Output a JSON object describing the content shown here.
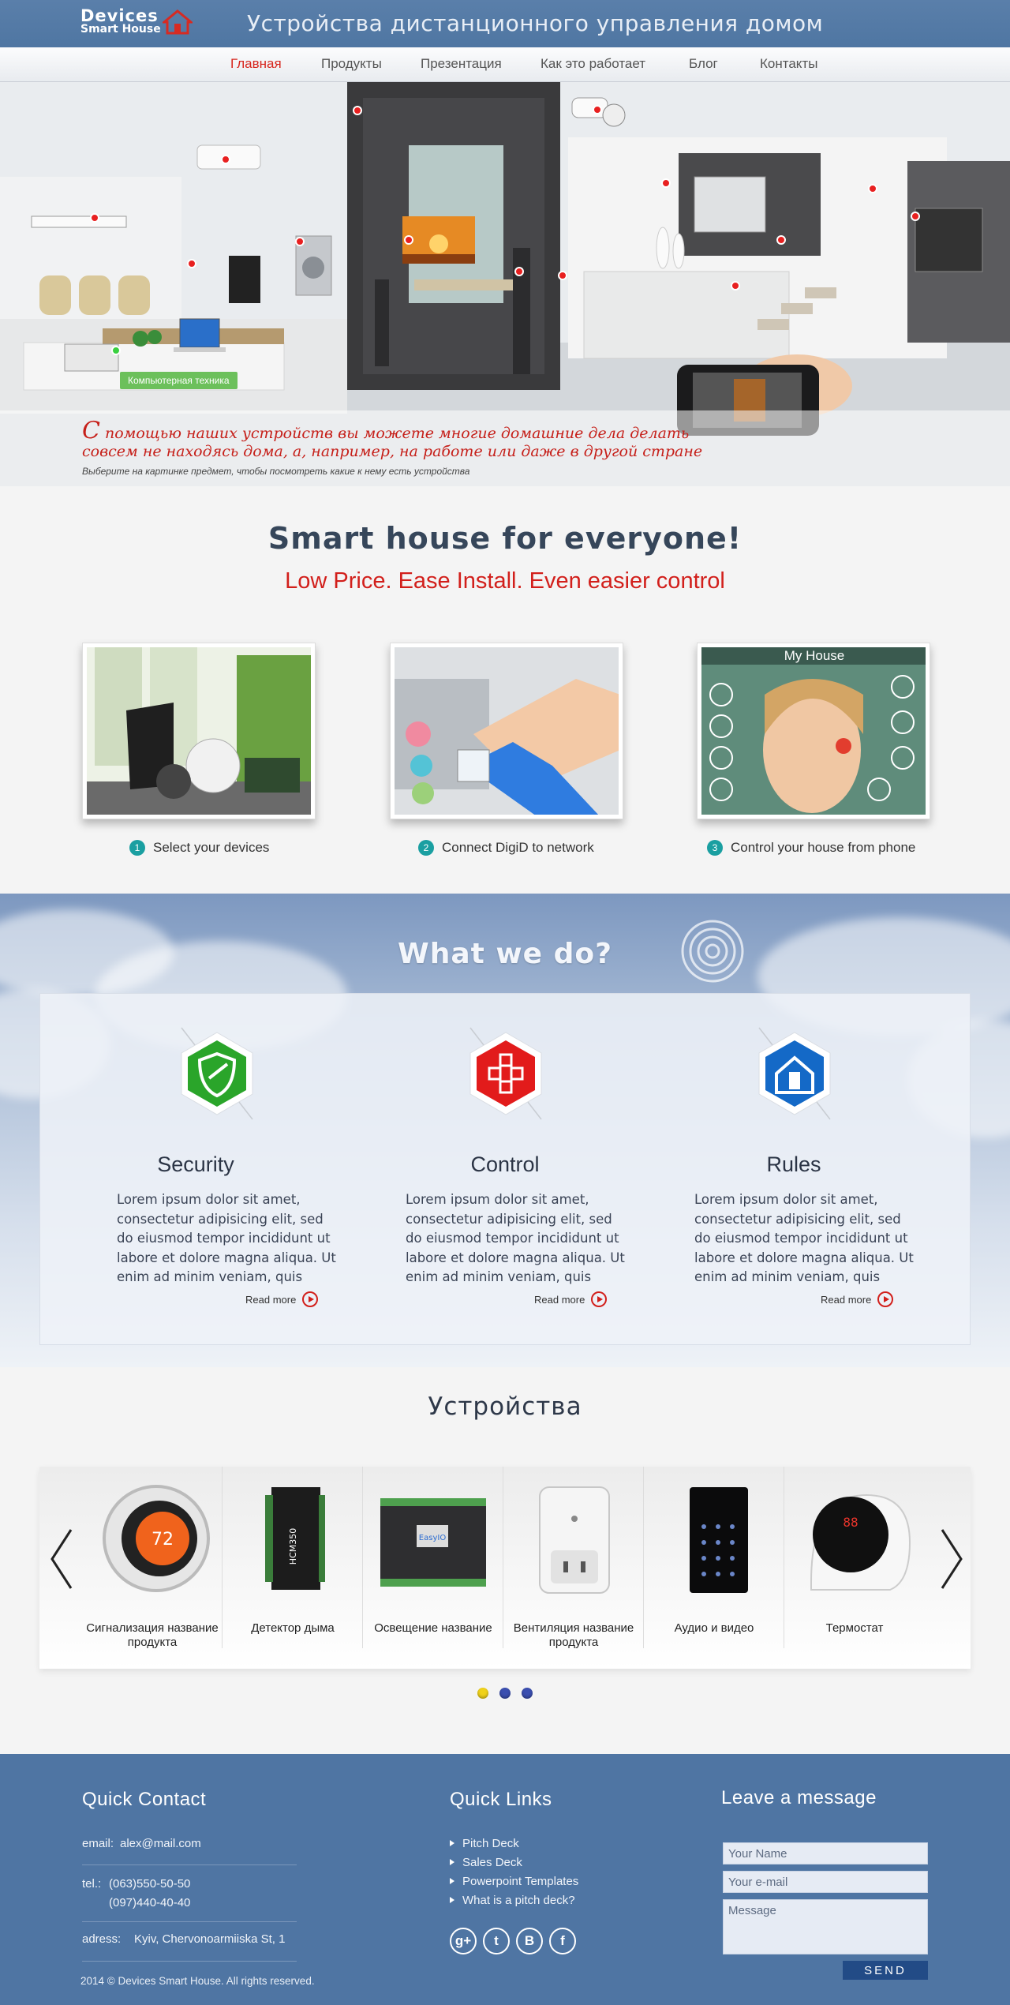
{
  "header": {
    "logo_line1": "Devices",
    "logo_line2": "Smart House",
    "site_title": "Устройства дистанционного управления домом"
  },
  "nav": {
    "items": [
      {
        "label": "Главная",
        "active": true
      },
      {
        "label": "Продукты",
        "active": false
      },
      {
        "label": "Презентация",
        "active": false
      },
      {
        "label": "Как это работает",
        "active": false
      },
      {
        "label": "Блог",
        "active": false
      },
      {
        "label": "Контакты",
        "active": false
      }
    ]
  },
  "hero": {
    "tag": "Компьютерная техника",
    "caption_first_letter": "С",
    "caption_line1_rest": " помощью наших устройств вы можете многие домашние дела делать",
    "caption_line2": "совсем не находясь дома, а, например, на работе или даже в другой стране",
    "caption_hint": "Выберите на картинке предмет, чтобы посмотреть какие к нему есть устройства"
  },
  "intro": {
    "title": "Smart house for everyone!",
    "subtitle": "Low Price. Ease Install. Even easier control",
    "steps": [
      {
        "num": "1",
        "label": "Select your devices"
      },
      {
        "num": "2",
        "label": "Connect DigiD to network"
      },
      {
        "num": "3",
        "label": "Control your house from phone",
        "image_title": "My House"
      }
    ]
  },
  "services": {
    "title": "What we do?",
    "items": [
      {
        "title": "Security",
        "text": "Lorem ipsum dolor sit amet, consectetur adipisicing elit, sed do eiusmod tempor incididunt ut labore et dolore magna aliqua. Ut enim ad minim veniam, quis",
        "read_more": "Read more",
        "icon": "shield-icon",
        "color": "#2aa52a"
      },
      {
        "title": "Control",
        "text": "Lorem ipsum dolor sit amet, consectetur adipisicing elit, sed do eiusmod tempor incididunt ut labore et dolore magna aliqua. Ut enim ad minim veniam, quis",
        "read_more": "Read more",
        "icon": "gamepad-icon",
        "color": "#e21b1b"
      },
      {
        "title": "Rules",
        "text": "Lorem ipsum dolor sit amet, consectetur adipisicing elit, sed do eiusmod tempor incididunt ut labore et dolore magna aliqua. Ut enim ad minim veniam, quis",
        "read_more": "Read more",
        "icon": "house-rules-icon",
        "color": "#1469c7"
      }
    ]
  },
  "devices": {
    "title": "Устройства",
    "products": [
      {
        "name": "Сигнализация название продукта",
        "image_text": "72"
      },
      {
        "name": "Детектор дыма",
        "image_text": "HCM350"
      },
      {
        "name": "Освещение название",
        "image_text": "EasyIO"
      },
      {
        "name": "Вентиляция название продукта"
      },
      {
        "name": "Аудио и видео"
      },
      {
        "name": "Термостат",
        "image_text": "88"
      }
    ],
    "dots": [
      {
        "color": "#f0d21a",
        "active": true
      },
      {
        "color": "#3b4fb0",
        "active": false
      },
      {
        "color": "#3b4fb0",
        "active": false
      }
    ]
  },
  "footer": {
    "contact_title": "Quick Contact",
    "email_label": "email:",
    "email_value": "alex@mail.com",
    "tel_label": "tel.:",
    "tel_values": [
      "(063)550-50-50",
      "(097)440-40-40"
    ],
    "address_label": "adress:",
    "address_value": "Kyiv, Chervonoarmiiska St, 1",
    "links_title": "Quick Links",
    "links": [
      "Pitch Deck",
      "Sales Deck",
      "Powerpoint Templates",
      "What is a pitch deck?"
    ],
    "social": [
      {
        "icon": "google-plus-icon",
        "glyph": "g+"
      },
      {
        "icon": "twitter-icon",
        "glyph": "t"
      },
      {
        "icon": "vk-icon",
        "glyph": "B"
      },
      {
        "icon": "facebook-icon",
        "glyph": "f"
      }
    ],
    "message_title": "Leave a message",
    "name_placeholder": "Your Name",
    "email_placeholder": "Your e-mail",
    "message_placeholder": "Message",
    "send_label": "SEND",
    "copyright": "2014 © Devices Smart House.  All rights reserved."
  }
}
